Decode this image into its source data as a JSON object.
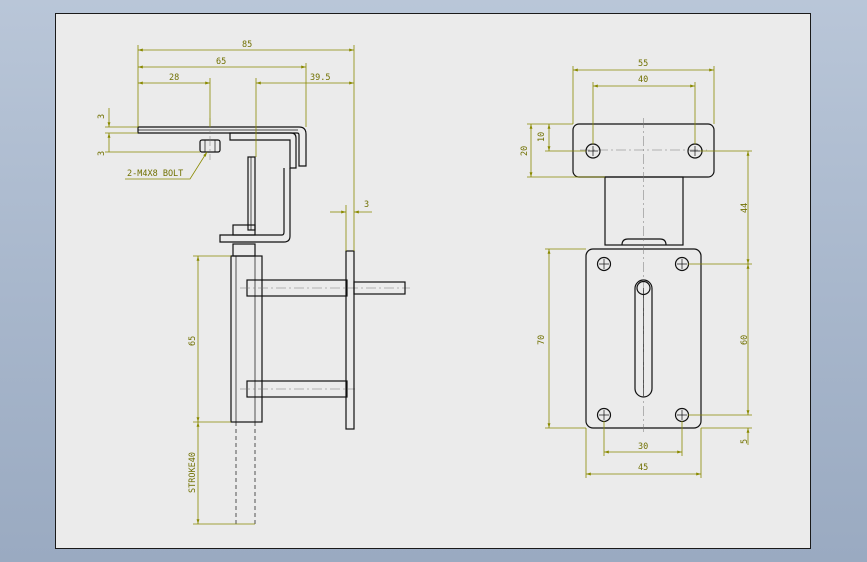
{
  "drawing": {
    "side_view": {
      "dims": {
        "overall_width": "85",
        "bracket_width": "65",
        "bolt_offset": "28",
        "rod_offset": "39.5",
        "top_thickness": "3",
        "bolt_head": "3",
        "bolt_note": "2-M4X8 BOLT",
        "plate_thickness": "3",
        "body_height": "65",
        "stroke": "STROKE40"
      }
    },
    "front_view": {
      "dims": {
        "top_width": "55",
        "hole_pitch_top": "40",
        "hole_offset": "10",
        "top_height": "20",
        "upper_hole_spacing": "44",
        "plate_height": "70",
        "lower_hole_spacing": "60",
        "lower_hole_pitch": "30",
        "plate_width": "45",
        "bottom_offset": "5"
      }
    }
  }
}
